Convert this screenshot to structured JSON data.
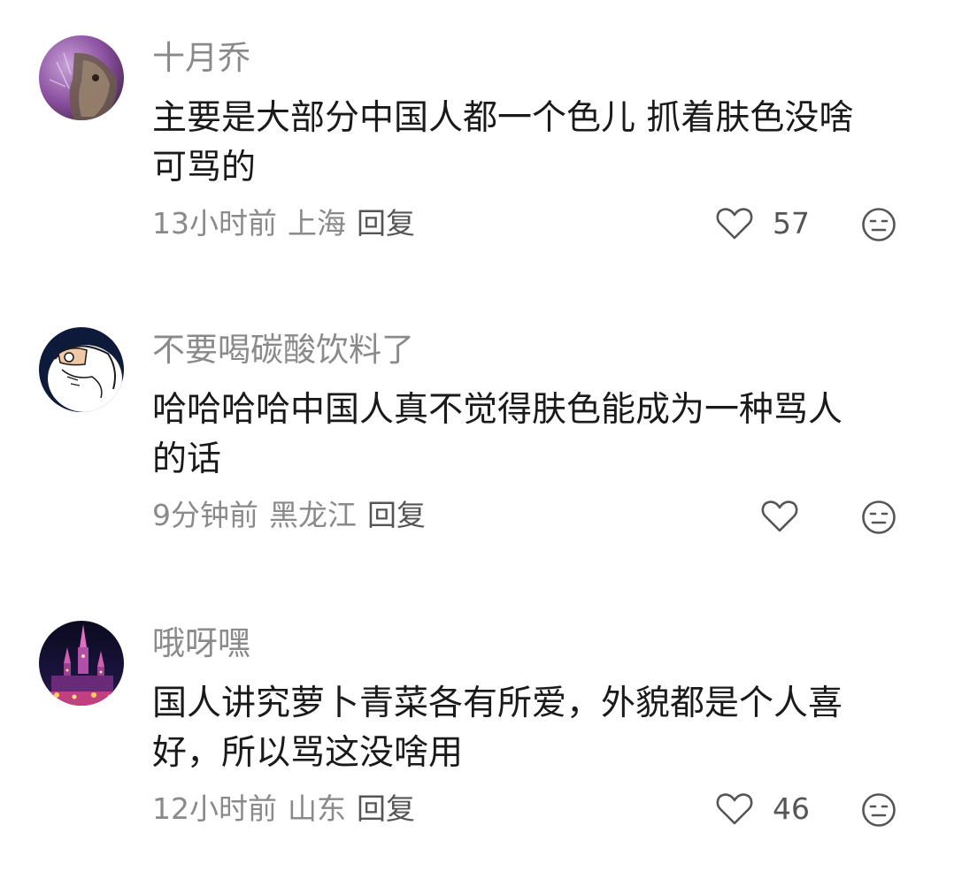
{
  "comments": [
    {
      "username": "十月乔",
      "content_line1": "主要是大部分中国人都一个色儿 抓着肤色没啥",
      "content_line2": "可骂的",
      "time": "13小时前",
      "location": "上海",
      "reply_label": "回复",
      "likes": "57",
      "like_icon": "heart-outline-icon",
      "dislike_icon": "neutral-face-icon"
    },
    {
      "username": "不要喝碳酸饮料了",
      "content_line1": "哈哈哈哈中国人真不觉得肤色能成为一种骂人",
      "content_line2": "的话",
      "time": "9分钟前",
      "location": "黑龙江",
      "reply_label": "回复",
      "likes": "",
      "like_icon": "heart-outline-icon",
      "dislike_icon": "neutral-face-icon"
    },
    {
      "username": "哦呀嘿",
      "content_line1": "国人讲究萝卜青菜各有所爱，外貌都是个人喜",
      "content_line2": "好，所以骂这没啥用",
      "time": "12小时前",
      "location": "山东",
      "reply_label": "回复",
      "likes": "46",
      "like_icon": "heart-outline-icon",
      "dislike_icon": "neutral-face-icon"
    }
  ],
  "colors": {
    "username": "#8a8a8a",
    "content": "#1a1a1a",
    "meta": "#8a8a8a",
    "icon": "#555555"
  }
}
